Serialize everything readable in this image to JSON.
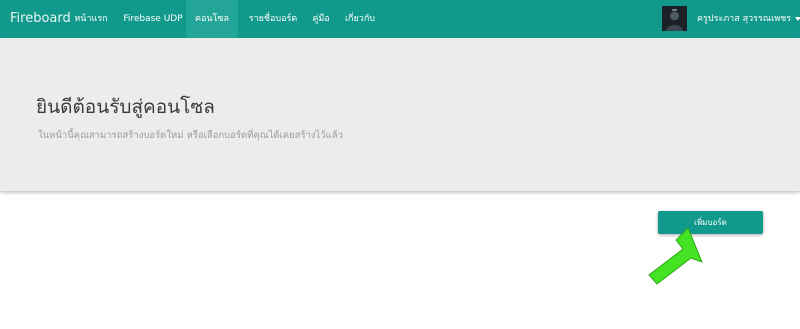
{
  "navbar": {
    "brand": "Fireboard",
    "items": [
      {
        "label": "หน้าแรก",
        "active": false
      },
      {
        "label": "Firebase UDP",
        "active": false
      },
      {
        "label": "คอนโซล",
        "active": true
      },
      {
        "label": "รายชื่อบอร์ด",
        "active": false
      },
      {
        "label": "คู่มือ",
        "active": false
      },
      {
        "label": "เกี่ยวกับ",
        "active": false
      }
    ],
    "user_name": "ครูประภาส สุวรรณเพชร"
  },
  "jumbotron": {
    "title": "ยินดีต้อนรับสู่คอนโซล",
    "subtitle": "ในหน้านี้คุณสามารถสร้างบอร์ดใหม่ หรือเลือกบอร์ดที่คุณได้เคยสร้างไว้แล้ว"
  },
  "actions": {
    "add_board_label": "เพิ่มบอร์ด"
  },
  "colors": {
    "navbar": "#119a8b",
    "nav_active": "#23a697",
    "jumbotron_bg": "#ececec",
    "button": "#119a8b",
    "annotation_arrow": "#44e324"
  },
  "annotation": {
    "arrow_icon": "arrow-pointer-icon"
  }
}
